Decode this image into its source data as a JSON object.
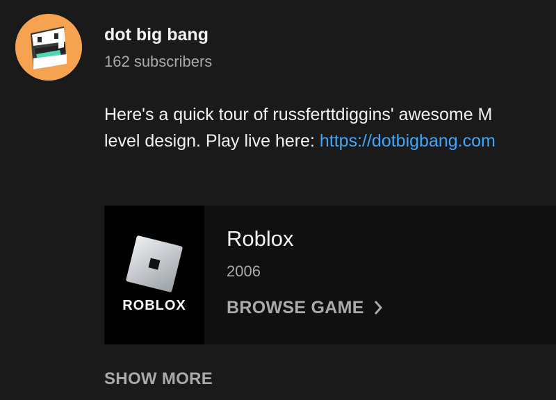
{
  "channel": {
    "name": "dot big bang",
    "subscribers": "162 subscribers",
    "avatar_icon": "dot-big-bang-mascot-icon",
    "avatar_color": "#f5a350"
  },
  "description": {
    "line1": "Here's a quick tour of russferttdiggins' awesome M",
    "line2_text": "level design. Play live here: ",
    "line2_link": "https://dotbigbang.com",
    "link_color": "#3ea6ff"
  },
  "game_card": {
    "title": "Roblox",
    "year": "2006",
    "browse_label": "BROWSE GAME",
    "browse_icon": "chevron-right-icon",
    "logo_text": "ROBLOX",
    "logo_icon": "roblox-logo-icon"
  },
  "show_more_label": "SHOW MORE",
  "colors": {
    "background": "#1a1a1a",
    "card_background": "#101010",
    "primary_text": "#f1f1f1",
    "secondary_text": "#aaaaaa"
  }
}
